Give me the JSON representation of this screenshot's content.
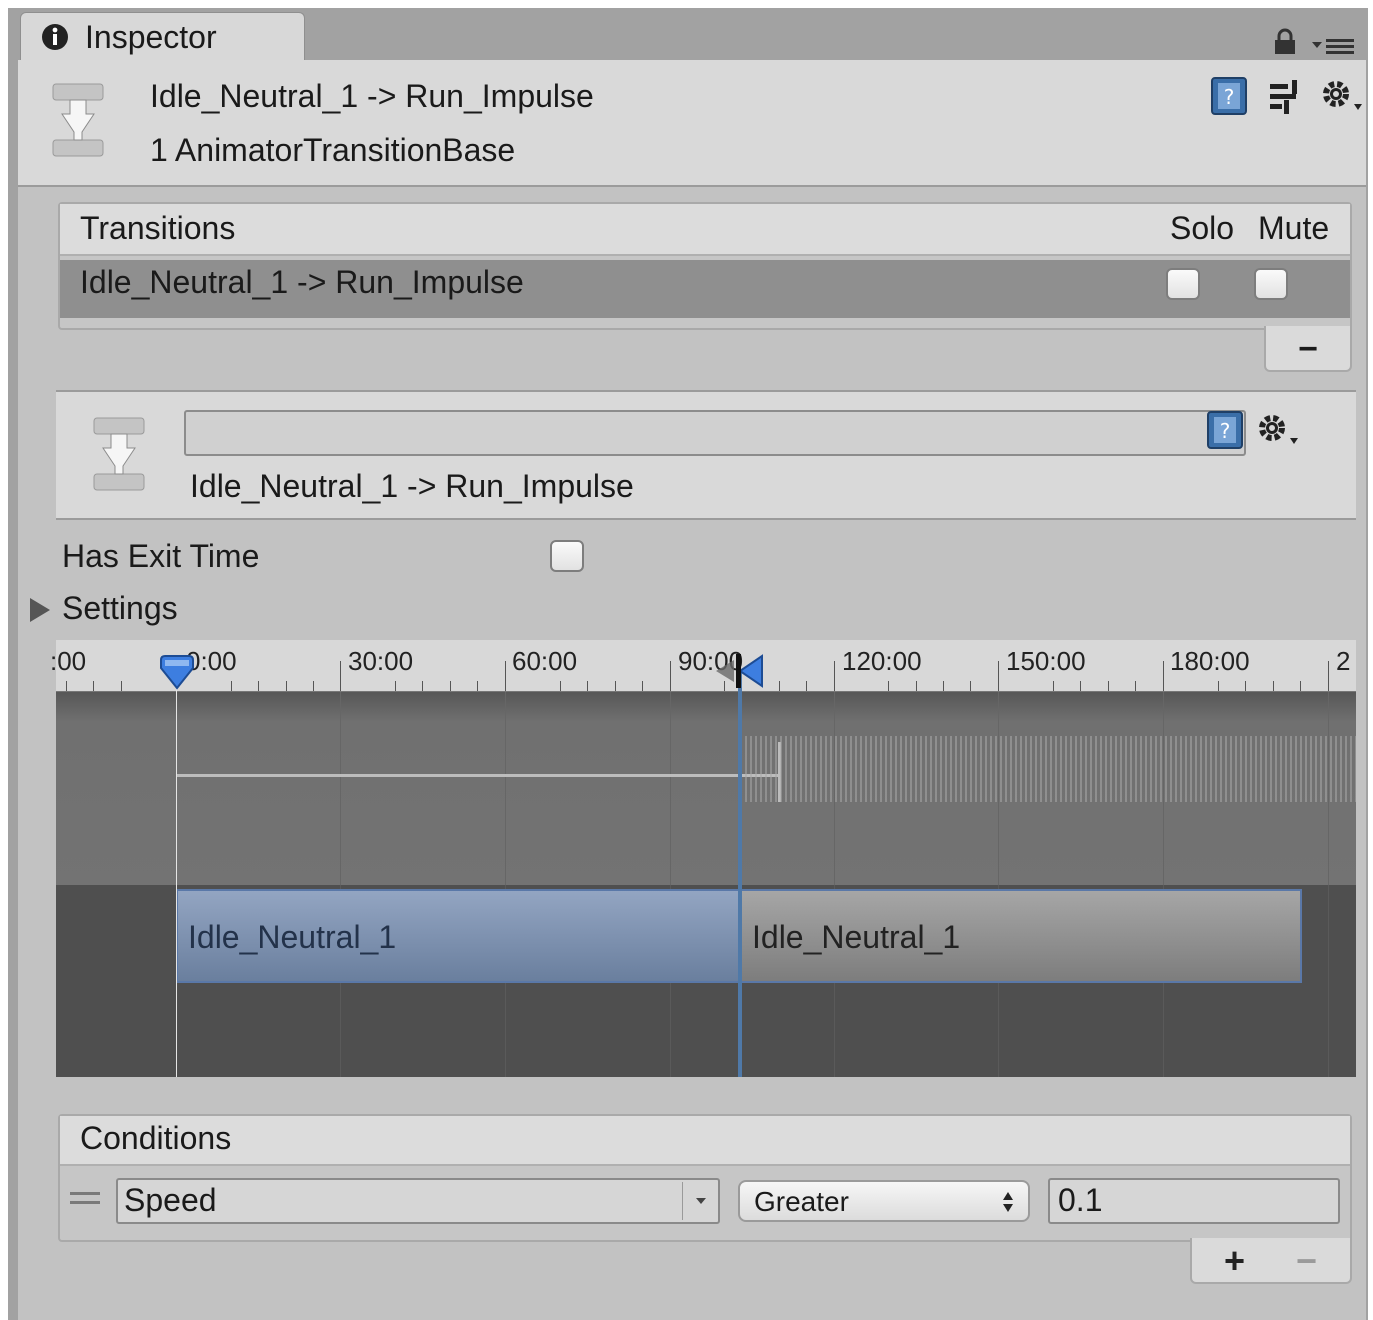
{
  "inspector": {
    "tab_title": "Inspector",
    "title": "Idle_Neutral_1 -> Run_Impulse",
    "subtitle": "1 AnimatorTransitionBase"
  },
  "transitions": {
    "header": "Transitions",
    "solo_label": "Solo",
    "mute_label": "Mute",
    "items": [
      {
        "label": "Idle_Neutral_1 -> Run_Impulse",
        "solo": false,
        "mute": false
      }
    ],
    "remove_label": "−"
  },
  "transition_detail": {
    "name_value": "",
    "label": "Idle_Neutral_1 -> Run_Impulse"
  },
  "has_exit_time": {
    "label": "Has Exit Time",
    "checked": false
  },
  "settings": {
    "label": "Settings",
    "expanded": false
  },
  "timeline": {
    "ticks": [
      ":00",
      "0:00",
      "30:00",
      "60:00",
      "90:00",
      "120:00",
      "150:00",
      "180:00",
      "2"
    ],
    "clip_source": "Idle_Neutral_1",
    "clip_destination": "Idle_Neutral_1",
    "source_color": "#8a9ab4",
    "destination_color": "#9a9a9a"
  },
  "conditions": {
    "header": "Conditions",
    "rows": [
      {
        "parameter": "Speed",
        "mode": "Greater",
        "value": "0.1"
      }
    ],
    "add_label": "+",
    "remove_label": "−"
  },
  "icons": [
    "info-icon",
    "lock-icon",
    "menu-icon",
    "help-icon",
    "preset-icon",
    "gear-icon",
    "transition-icon",
    "foldout-arrow-icon",
    "drag-handle-icon"
  ]
}
